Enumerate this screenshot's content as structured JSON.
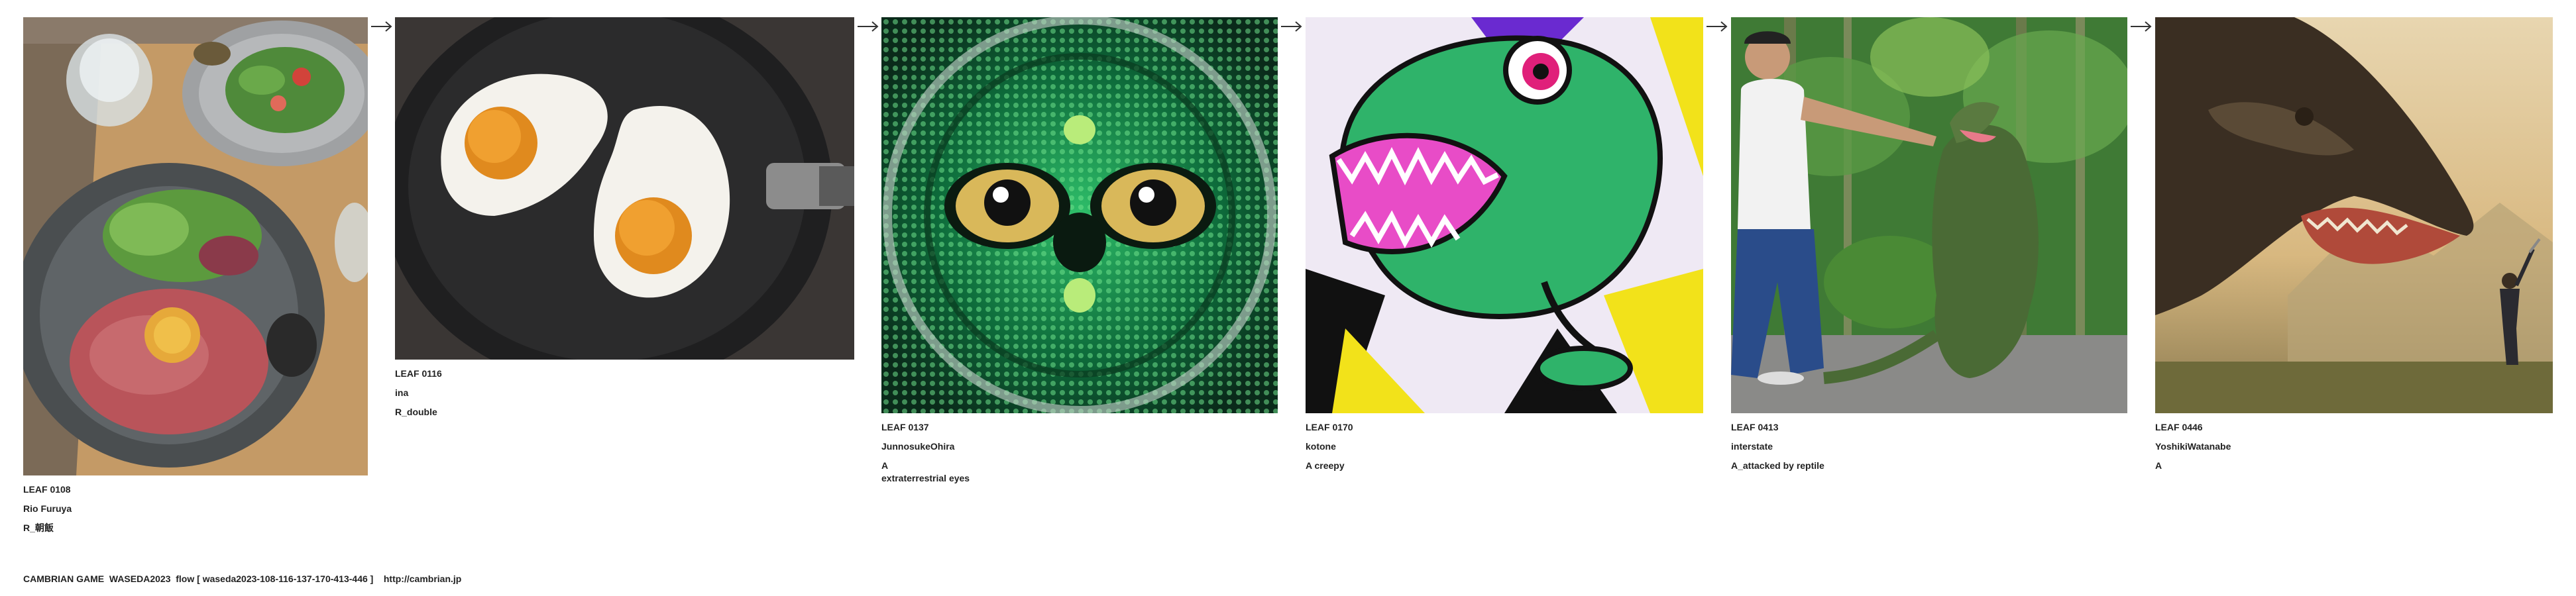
{
  "leaves": [
    {
      "id": "LEAF 0108",
      "author": "Rio Furuya",
      "title": "R_朝飯",
      "image": "roast beef bowl with salad and glass of water on wooden table"
    },
    {
      "id": "LEAF 0116",
      "author": "ina",
      "title": "R_double",
      "image": "two fried eggs in a black frying pan"
    },
    {
      "id": "LEAF 0137",
      "author": "JunnosukeOhira",
      "title": "A\nextraterrestrial eyes",
      "image": "symmetric green reptilian alien face with two eyes"
    },
    {
      "id": "LEAF 0170",
      "author": "kotone",
      "title": "A creepy",
      "image": "comic-style green dinosaur roaring"
    },
    {
      "id": "LEAF 0413",
      "author": "interstate",
      "title": "A_attacked by reptile",
      "image": "man touching a green lizard monster in a jungle"
    },
    {
      "id": "LEAF 0446",
      "author": "YoshikiWatanabe",
      "title": "A",
      "image": "giant dinosaur roaring at a small human in a hazy landscape"
    }
  ],
  "arrow_icon": "right-arrow-icon",
  "footer": {
    "text": "CAMBRIAN GAME  WASEDA2023  flow [ waseda2023-108-116-137-170-413-446 ]    http://cambrian.jp"
  }
}
